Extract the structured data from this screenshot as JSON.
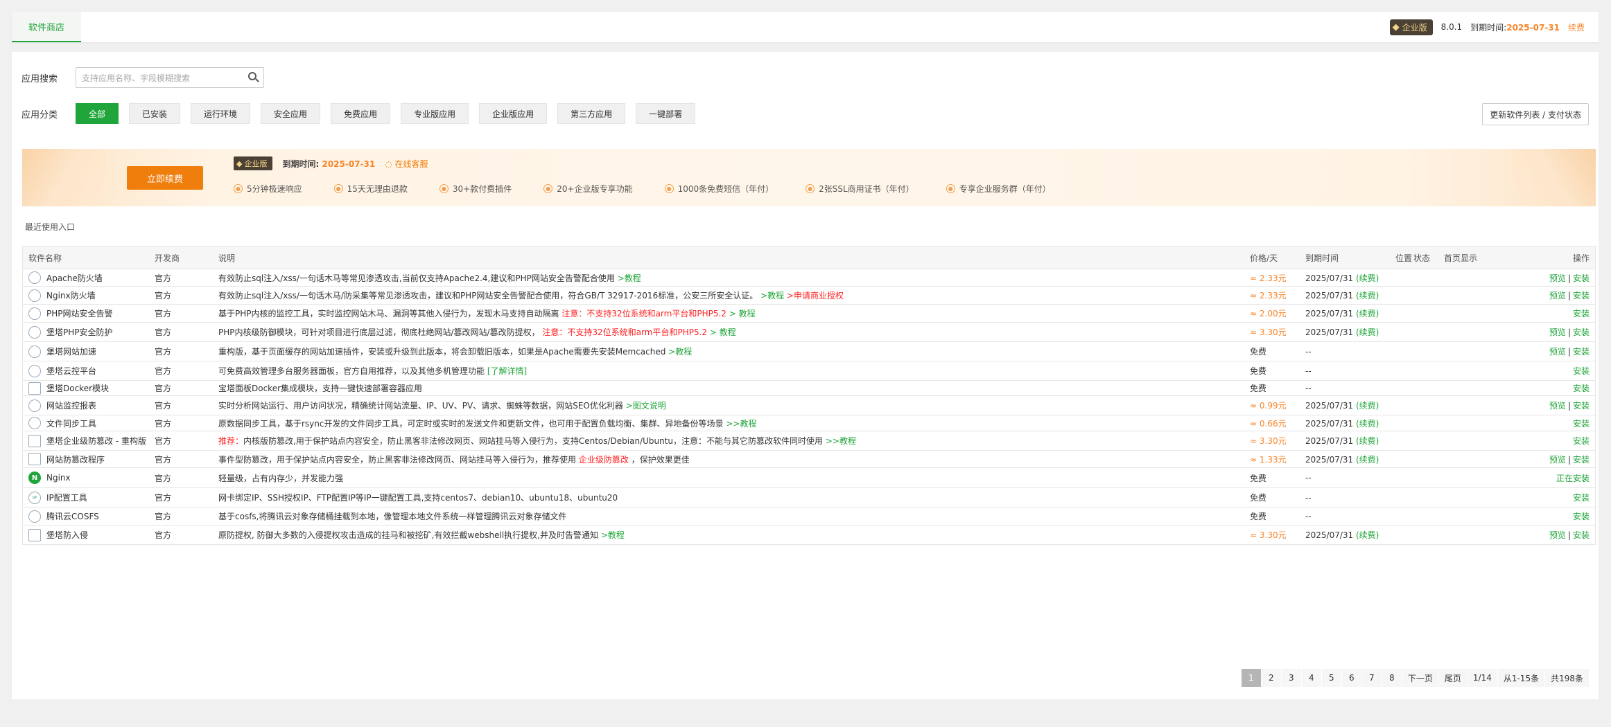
{
  "header": {
    "tab": "软件商店",
    "edition": "企业版",
    "version": "8.0.1",
    "expire_label": "到期时间:",
    "expire_date": "2025-07-31",
    "renew": "续费"
  },
  "search": {
    "label": "应用搜索",
    "placeholder": "支持应用名称、字段模糊搜索"
  },
  "categories": {
    "label": "应用分类",
    "items": [
      "全部",
      "已安装",
      "运行环境",
      "安全应用",
      "免费应用",
      "专业版应用",
      "企业版应用",
      "第三方应用",
      "一键部署"
    ],
    "update_button": "更新软件列表 / 支付状态"
  },
  "banner": {
    "renew_button": "立即续费",
    "edition": "企业版",
    "expire_label": "到期时间:",
    "expire_date": "2025-07-31",
    "service": "在线客服",
    "features": [
      "5分钟极速响应",
      "15天无理由退款",
      "30+款付费插件",
      "20+企业版专享功能",
      "1000条免费短信（年付）",
      "2张SSL商用证书（年付）",
      "专享企业服务群（年付）"
    ]
  },
  "recent_label": "最近使用入口",
  "table": {
    "headers": {
      "name": "软件名称",
      "dev": "开发商",
      "desc": "说明",
      "price": "价格/天",
      "expire": "到期时间",
      "pos": "位置",
      "status": "状态",
      "home": "首页显示",
      "op": "操作"
    },
    "rows": [
      {
        "name": "Apache防火墙",
        "icon": "waf-icon",
        "dev": "官方",
        "desc": "有效防止sql注入/xss/一句话木马等常见渗透攻击,当前仅支持Apache2.4,建议和PHP网站安全告警配合使用",
        "desc_link": ">教程",
        "desc_red": "",
        "desc_link2": "",
        "price": "≈ 2.33元",
        "expire": "2025/07/31",
        "renew": "(续费)",
        "preview": "预览",
        "sep": "|",
        "op": "安装"
      },
      {
        "name": "Nginx防火墙",
        "icon": "waf-icon",
        "dev": "官方",
        "desc": "有效防止sql注入/xss/一句话木马/防采集等常见渗透攻击，建议和PHP网站安全告警配合使用，符合GB/T 32917-2016标准，公安三所安全认证。",
        "desc_link": ">教程",
        "desc_red": ">申请商业授权",
        "desc_link2": "",
        "price": "≈ 2.33元",
        "expire": "2025/07/31",
        "renew": "(续费)",
        "preview": "预览",
        "sep": "|",
        "op": "安装"
      },
      {
        "name": "PHP网站安全告警",
        "icon": "alarm-icon",
        "dev": "官方",
        "desc": "基于PHP内核的监控工具，实时监控网站木马、漏洞等其他入侵行为，发现木马支持自动隔离",
        "desc_link": "",
        "desc_red": "注意：不支持32位系统和arm平台和PHP5.2",
        "desc_link2": "> 教程",
        "price": "≈ 2.00元",
        "expire": "2025/07/31",
        "renew": "(续费)",
        "preview": "",
        "sep": "",
        "op": "安装"
      },
      {
        "name": "堡塔PHP安全防护",
        "icon": "php-shield-icon",
        "dev": "官方",
        "desc": "PHP内核级防御模块，可针对项目进行底层过滤，彻底杜绝网站/篡改网站/篡改防提权，",
        "desc_link": "",
        "desc_red": "注意：不支持32位系统和arm平台和PHP5.2",
        "desc_link2": "> 教程",
        "price": "≈ 3.30元",
        "expire": "2025/07/31",
        "renew": "(续费)",
        "preview": "预览",
        "sep": "|",
        "op": "安装"
      },
      {
        "name": "堡塔网站加速",
        "icon": "lightning-icon",
        "dev": "官方",
        "desc": "重构版，基于页面缓存的网站加速插件，安装或升级到此版本，将会卸载旧版本，如果是Apache需要先安装Memcached",
        "desc_link": ">教程",
        "desc_red": "",
        "desc_link2": "",
        "price": "免费",
        "expire": "--",
        "renew": "",
        "preview": "预览",
        "sep": "|",
        "op": "安装"
      },
      {
        "name": "堡塔云控平台",
        "icon": "cloud-tree-icon",
        "dev": "官方",
        "desc": "可免费高效管理多台服务器面板，官方自用推荐，以及其他多机管理功能",
        "desc_link": "[了解详情]",
        "desc_red": "",
        "desc_link2": "",
        "price": "免费",
        "expire": "--",
        "renew": "",
        "preview": "",
        "sep": "",
        "op": "安装"
      },
      {
        "name": "堡塔Docker模块",
        "icon": "broken-image-icon",
        "dev": "官方",
        "desc": "宝塔面板Docker集成模块，支持一键快速部署容器应用",
        "desc_link": "",
        "desc_red": "",
        "desc_link2": "",
        "price": "免费",
        "expire": "--",
        "renew": "",
        "preview": "",
        "sep": "",
        "op": "安装"
      },
      {
        "name": "网站监控报表",
        "icon": "globe-icon",
        "dev": "官方",
        "desc": "实时分析网站运行、用户访问状况，精确统计网站流量、IP、UV、PV、请求、蜘蛛等数据，网站SEO优化利器",
        "desc_link": ">图文说明",
        "desc_red": "",
        "desc_link2": "",
        "price": "≈ 0.99元",
        "expire": "2025/07/31",
        "renew": "(续费)",
        "preview": "预览",
        "sep": "|",
        "op": "安装"
      },
      {
        "name": "文件同步工具",
        "icon": "database-icon",
        "dev": "官方",
        "desc": "原数据同步工具，基于rsync开发的文件同步工具，可定时或实时的发送文件和更新文件，也可用于配置负载均衡、集群、异地备份等场景",
        "desc_link": ">>教程",
        "desc_red": "",
        "desc_link2": "",
        "price": "≈ 0.66元",
        "expire": "2025/07/31",
        "renew": "(续费)",
        "preview": "",
        "sep": "",
        "op": "安装"
      },
      {
        "name": "堡塔企业级防篡改 - 重构版",
        "icon": "page-lock-icon",
        "dev": "官方",
        "desc_red_pre": "推荐：",
        "desc": "内核版防篡改,用于保护站点内容安全，防止黑客非法修改网页、网站挂马等入侵行为，支持Centos/Debian/Ubuntu，注意：不能与其它防篡改软件同时使用",
        "desc_link": ">>教程",
        "desc_red": "",
        "desc_link2": "",
        "price": "≈ 3.30元",
        "expire": "2025/07/31",
        "renew": "(续费)",
        "preview": "",
        "sep": "",
        "op": "安装"
      },
      {
        "name": "网站防篡改程序",
        "icon": "page-lock-icon",
        "dev": "官方",
        "desc": "事件型防篡改，用于保护站点内容安全，防止黑客非法修改网页、网站挂马等入侵行为，推荐使用",
        "desc_link": "",
        "desc_red": "企业级防篡改",
        "desc_link2": "，保护效果更佳",
        "price": "≈ 1.33元",
        "expire": "2025/07/31",
        "renew": "(续费)",
        "preview": "预览",
        "sep": "|",
        "op": "安装"
      },
      {
        "name": "Nginx",
        "icon": "nginx-icon",
        "dev": "官方",
        "desc": "轻量级，占有内存少，并发能力强",
        "desc_link": "",
        "desc_red": "",
        "desc_link2": "",
        "price": "免费",
        "expire": "--",
        "renew": "",
        "preview": "",
        "sep": "",
        "op": "正在安装"
      },
      {
        "name": "IP配置工具",
        "icon": "ip-icon",
        "dev": "官方",
        "desc": "网卡绑定IP、SSH授权IP、FTP配置IP等IP一键配置工具,支持centos7、debian10、ubuntu18、ubuntu20",
        "desc_link": "",
        "desc_red": "",
        "desc_link2": "",
        "price": "免费",
        "expire": "--",
        "renew": "",
        "preview": "",
        "sep": "",
        "op": "安装"
      },
      {
        "name": "腾讯云COSFS",
        "icon": "cosfs-icon",
        "dev": "官方",
        "desc": "基于cosfs,将腾讯云对象存储桶挂载到本地，像管理本地文件系统一样管理腾讯云对象存储文件",
        "desc_link": "",
        "desc_red": "",
        "desc_link2": "",
        "price": "免费",
        "expire": "--",
        "renew": "",
        "preview": "",
        "sep": "",
        "op": "安装"
      },
      {
        "name": "堡塔防入侵",
        "icon": "terminal-icon",
        "dev": "官方",
        "desc": "原防提权, 防御大多数的入侵提权攻击造成的挂马和被挖矿,有效拦截webshell执行提权,并及时告警通知",
        "desc_link": ">教程",
        "desc_red": "",
        "desc_link2": "",
        "price": "≈ 3.30元",
        "expire": "2025/07/31",
        "renew": "(续费)",
        "preview": "预览",
        "sep": "|",
        "op": "安装"
      }
    ]
  },
  "pager": {
    "pages": [
      "1",
      "2",
      "3",
      "4",
      "5",
      "6",
      "7",
      "8"
    ],
    "next": "下一页",
    "last": "尾页",
    "page_info": "1/14",
    "range": "从1-15条",
    "total": "共198条"
  }
}
